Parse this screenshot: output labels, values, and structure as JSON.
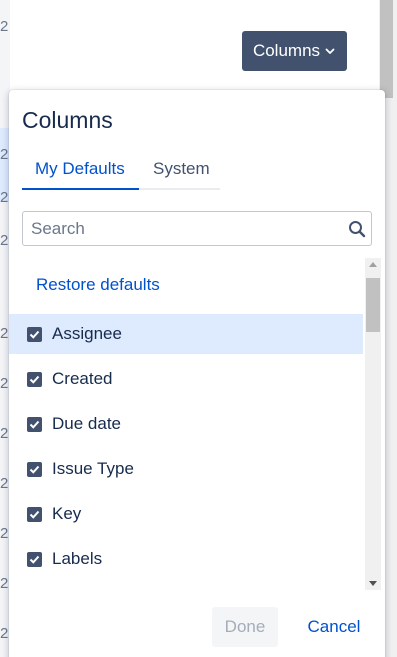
{
  "background": {
    "row_digits": [
      "2",
      "2",
      "2",
      "2",
      "2",
      "2",
      "2",
      "2",
      "2",
      "2",
      "2"
    ]
  },
  "toolbar": {
    "columns_label": "Columns"
  },
  "dialog": {
    "title": "Columns",
    "tabs": [
      {
        "label": "My Defaults",
        "active": true
      },
      {
        "label": "System",
        "active": false
      }
    ],
    "search": {
      "placeholder": "Search",
      "value": ""
    },
    "restore_label": "Restore defaults",
    "items": [
      {
        "label": "Assignee",
        "checked": true,
        "selected": true
      },
      {
        "label": "Created",
        "checked": true,
        "selected": false
      },
      {
        "label": "Due date",
        "checked": true,
        "selected": false
      },
      {
        "label": "Issue Type",
        "checked": true,
        "selected": false
      },
      {
        "label": "Key",
        "checked": true,
        "selected": false
      },
      {
        "label": "Labels",
        "checked": true,
        "selected": false
      }
    ],
    "done_label": "Done",
    "cancel_label": "Cancel"
  },
  "colors": {
    "primary": "#0052cc",
    "button_dark": "#42526e",
    "selected_row": "#deebff",
    "text": "#172b4d"
  },
  "icons": {
    "search": "search-icon",
    "chevron": "chevron-down-icon",
    "checkbox": "checkmark-icon"
  }
}
